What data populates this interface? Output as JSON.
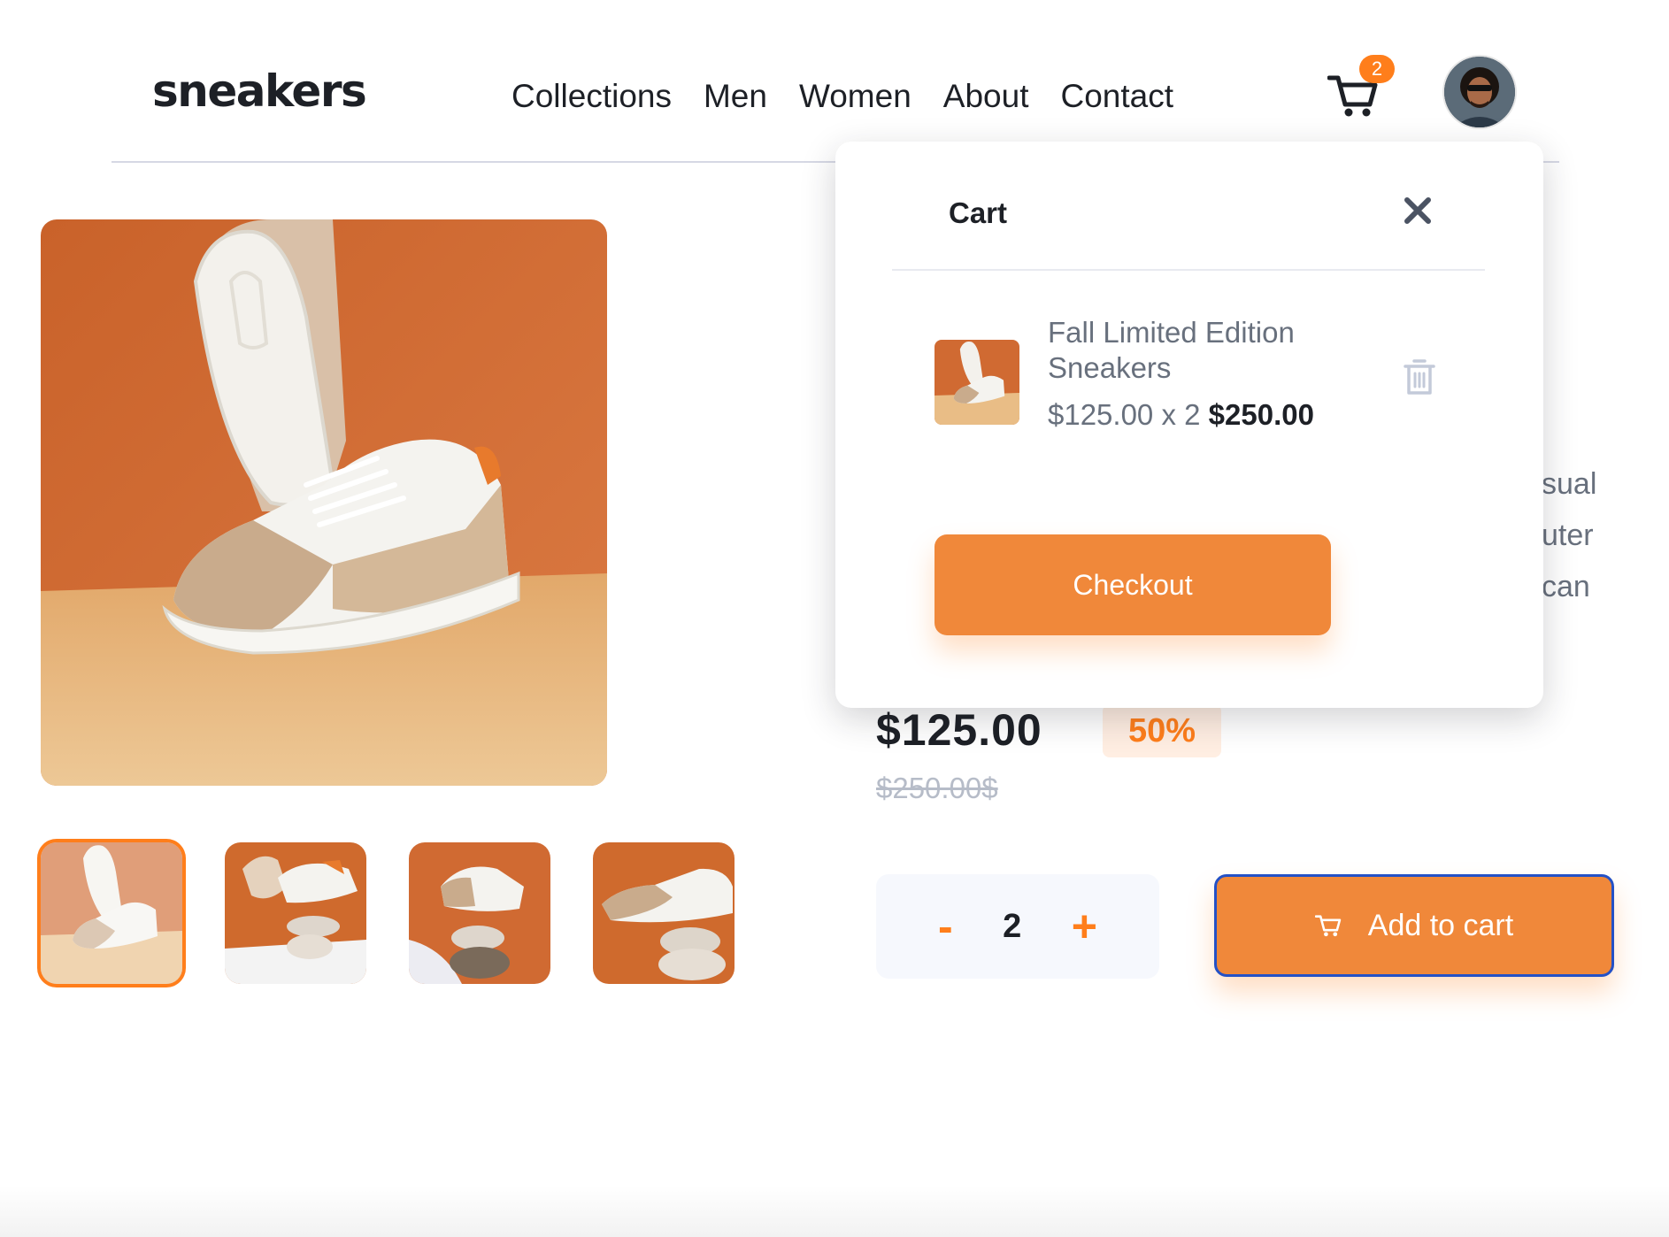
{
  "header": {
    "logo": "sneakers",
    "nav": [
      "Collections",
      "Men",
      "Women",
      "About",
      "Contact"
    ],
    "cart_count": "2",
    "cart_icon": "cart-icon",
    "avatar_icon": "avatar"
  },
  "colors": {
    "accent": "#ff7e1b",
    "accent_button": "#f0883a",
    "dark": "#1d2026",
    "muted": "#68707d",
    "focus_outline": "#2451c6"
  },
  "gallery": {
    "thumbnails": 4,
    "active_thumbnail": 1
  },
  "product": {
    "description_fragments": [
      "sual",
      "uter",
      "can"
    ],
    "price": "$125.00",
    "discount": "50%",
    "old_price": "$250.00$"
  },
  "quantity": {
    "minus": "-",
    "value": "2",
    "plus": "+"
  },
  "add_to_cart": {
    "label": "Add to cart",
    "icon": "cart-icon"
  },
  "cart_popup": {
    "title": "Cart",
    "close_icon": "close-icon",
    "item": {
      "name": "Fall Limited Edition Sneakers",
      "unit_price_and_qty": "$125.00 x 2",
      "total": "$250.00",
      "delete_icon": "trash-icon"
    },
    "checkout_label": "Checkout"
  }
}
